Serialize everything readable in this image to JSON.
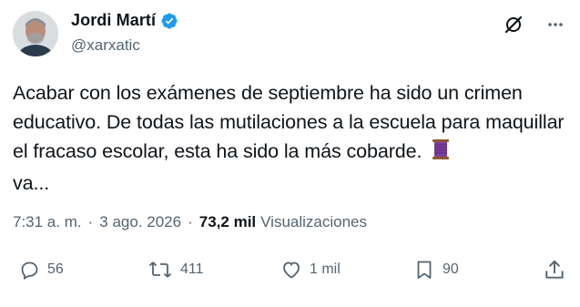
{
  "author": {
    "display_name": "Jordi Martí",
    "handle": "@xarxatic",
    "verified": true
  },
  "tweet": {
    "text": "Acabar con los exámenes de septiembre ha sido un crimen educativo. De todas las mutilaciones a la escuela para maquillar el fracaso escolar, esta ha sido la más cobarde.",
    "continuation": "va..."
  },
  "meta": {
    "time": "7:31 a. m.",
    "separator": "·",
    "date": "3 ago. 2026",
    "views_count": "73,2 mil",
    "views_label": "Visualizaciones"
  },
  "actions": {
    "replies": "56",
    "reposts": "411",
    "likes": "1 mil",
    "bookmarks": "90"
  },
  "colors": {
    "text": "#0f1419",
    "secondary": "#536471",
    "verified": "#1d9bf0"
  }
}
